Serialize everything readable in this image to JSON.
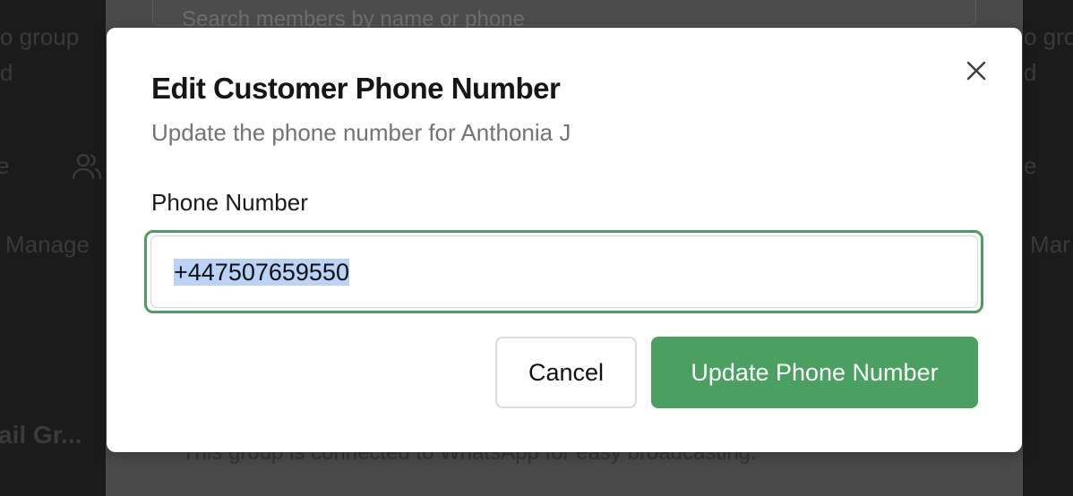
{
  "background": {
    "search_placeholder": "Search members by name or phone",
    "left_fragments": [
      "o group",
      "d",
      "e",
      "Manage",
      "ail Gr..."
    ],
    "right_fragments": [
      "o group",
      "d",
      "e",
      "Mar"
    ],
    "panel_note": "This group is connected to WhatsApp for easy broadcasting.",
    "icons": [
      "users-icon"
    ]
  },
  "modal": {
    "title": "Edit Customer Phone Number",
    "subtitle": "Update the phone number for Anthonia J",
    "close_icon": "close-icon",
    "field": {
      "label": "Phone Number",
      "value": "+447507659550",
      "selected": true
    },
    "buttons": {
      "cancel": "Cancel",
      "update": "Update Phone Number"
    }
  },
  "colors": {
    "accent_green": "#4aa061",
    "focus_ring": "#4e9c62",
    "selection": "#b9d3f7"
  }
}
